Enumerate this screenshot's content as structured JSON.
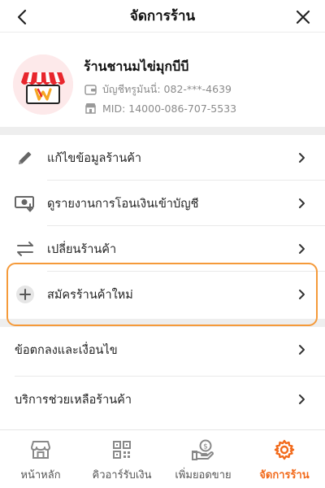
{
  "header": {
    "title": "จัดการร้าน",
    "back_icon": "chevron-left-icon",
    "close_icon": "close-icon"
  },
  "shop": {
    "name": "ร้านชานมไข่มุกบีบี",
    "account_label": "บัญชีทรูมันนี่: 082-***-4639",
    "mid_label": "MID: 14000-086-707-5533",
    "logo_icon": "storefront-logo-icon"
  },
  "menu": {
    "edit_shop": "แก้ไขข้อมูลร้านค้า",
    "transfer_report": "ดูรายงานการโอนเงินเข้าบัญชี",
    "switch_shop": "เปลี่ยนร้านค้า",
    "register_shop": "สมัครร้านค้าใหม่",
    "terms": "ข้อตกลงและเงื่อนไข",
    "merchant_support": "บริการช่วยเหลือร้านค้า"
  },
  "bottom_nav": {
    "home": "หน้าหลัก",
    "qr_receive": "คิวอาร์รับเงิน",
    "boost_sales": "เพิ่มยอดขาย",
    "manage_shop": "จัดการร้าน"
  },
  "colors": {
    "accent": "#f26a1b",
    "highlight_border": "#f59a3a",
    "secondary_text": "#8b8b8b",
    "logo_red": "#e8262d"
  }
}
